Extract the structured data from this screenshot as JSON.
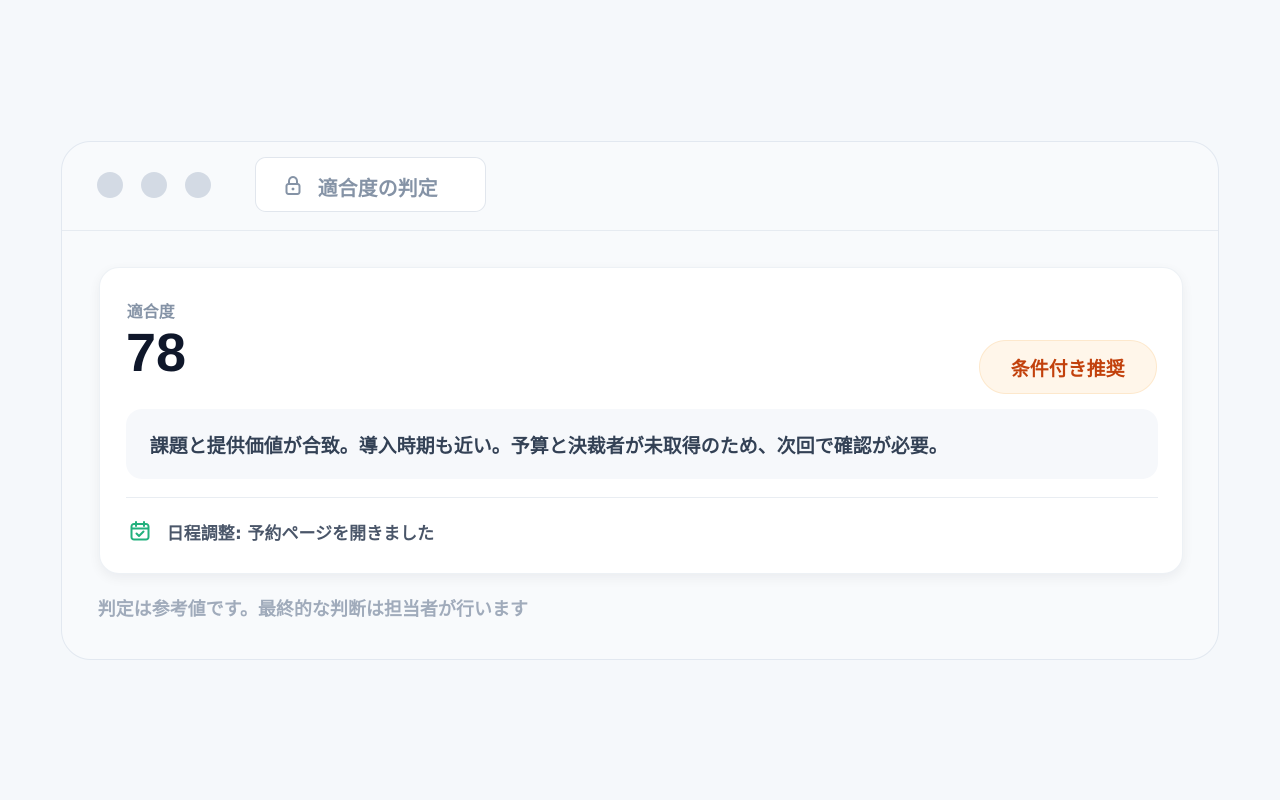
{
  "window": {
    "tab_title": "適合度の判定",
    "tab_icon": "lock-icon"
  },
  "score": {
    "label": "適合度",
    "value": "78",
    "badge": "条件付き推奨",
    "badge_color": "#c2410c"
  },
  "summary": {
    "text": "課題と提供価値が合致。導入時期も近い。予算と決裁者が未取得のため、次回で確認が必要。"
  },
  "schedule": {
    "icon": "calendar-check-icon",
    "icon_color": "#22b07d",
    "text": "日程調整: 予約ページを開きました"
  },
  "footnote": "判定は参考値です。最終的な判断は担当者が行います"
}
